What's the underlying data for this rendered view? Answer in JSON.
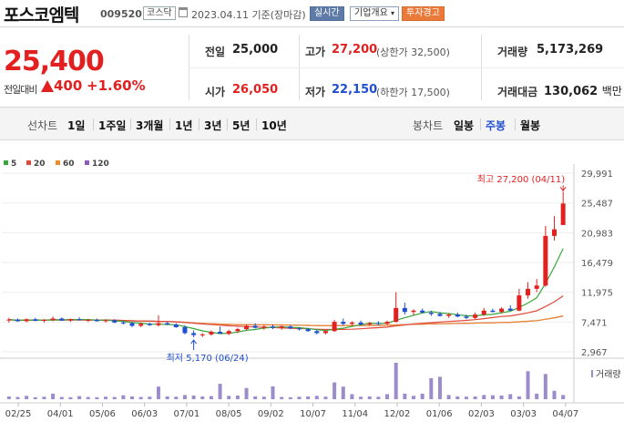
{
  "header": {
    "stock_name": "포스코엠텍",
    "stock_code": "009520",
    "market": "코스닥",
    "date": "2023.04.11",
    "basis": "기준(장마감)",
    "realtime_btn": "실시간",
    "company_info_btn": "기업개요",
    "warning_badge": "투자경고"
  },
  "summary": {
    "current_price": "25,400",
    "change_label": "전일대비",
    "change_value": "400",
    "change_pct": "+1.60%",
    "prev_close": {
      "label": "전일",
      "value": "25,000"
    },
    "high": {
      "label": "고가",
      "value": "27,200",
      "sub_label": "상한가",
      "sub_value": "32,500"
    },
    "volume": {
      "label": "거래량",
      "value": "5,173,269"
    },
    "open": {
      "label": "시가",
      "value": "26,050"
    },
    "low": {
      "label": "저가",
      "value": "22,150",
      "sub_label": "하한가",
      "sub_value": "17,500"
    },
    "amount": {
      "label": "거래대금",
      "value": "130,062",
      "unit": "백만"
    }
  },
  "period_bar": {
    "line_label": "선차트",
    "line_periods": [
      "1일",
      "1주일",
      "3개월",
      "1년",
      "3년",
      "5년",
      "10년"
    ],
    "candle_label": "봉차트",
    "candle_periods": [
      "일봉",
      "주봉",
      "월봉"
    ],
    "active_candle": "주봉"
  },
  "colors": {
    "up": "#e32020",
    "down": "#1f4fd0",
    "ma5": "#3aa63a",
    "ma20": "#e04a3a",
    "ma60": "#f08a2a",
    "ma120": "#8a5ab8",
    "volume": "#9d8ccc"
  },
  "chart_data": {
    "type": "candlestick",
    "legend": [
      {
        "name": "5",
        "color": "#3aa63a"
      },
      {
        "name": "20",
        "color": "#e04a3a"
      },
      {
        "name": "60",
        "color": "#f08a2a"
      },
      {
        "name": "120",
        "color": "#8a5ab8"
      }
    ],
    "y_ticks": [
      "29,991",
      "25,487",
      "20,983",
      "16,479",
      "11,975",
      "7,471",
      "2,967"
    ],
    "ylim": [
      2967,
      29991
    ],
    "x_ticks": [
      "02/25",
      "04/01",
      "05/06",
      "06/03",
      "07/01",
      "08/05",
      "09/02",
      "10/07",
      "11/04",
      "12/02",
      "01/06",
      "02/03",
      "03/03",
      "04/07"
    ],
    "annotation_high": "최고 27,200 (04/11)",
    "annotation_low": "최저 5,170 (06/24)",
    "volume_label": "거래량",
    "candles": [
      {
        "o": 7700,
        "h": 8100,
        "l": 7400,
        "c": 7850
      },
      {
        "o": 7850,
        "h": 8000,
        "l": 7500,
        "c": 7600
      },
      {
        "o": 7600,
        "h": 8000,
        "l": 7450,
        "c": 7900
      },
      {
        "o": 7900,
        "h": 8100,
        "l": 7600,
        "c": 7650
      },
      {
        "o": 7650,
        "h": 7900,
        "l": 7400,
        "c": 7800
      },
      {
        "o": 7800,
        "h": 8300,
        "l": 7600,
        "c": 8000
      },
      {
        "o": 8000,
        "h": 8150,
        "l": 7650,
        "c": 7700
      },
      {
        "o": 7700,
        "h": 8000,
        "l": 7500,
        "c": 7900
      },
      {
        "o": 7900,
        "h": 8200,
        "l": 7700,
        "c": 7750
      },
      {
        "o": 7750,
        "h": 7950,
        "l": 7500,
        "c": 7800
      },
      {
        "o": 7800,
        "h": 8000,
        "l": 7550,
        "c": 7600
      },
      {
        "o": 7600,
        "h": 7900,
        "l": 7400,
        "c": 7750
      },
      {
        "o": 7750,
        "h": 7900,
        "l": 7300,
        "c": 7400
      },
      {
        "o": 7400,
        "h": 7700,
        "l": 7100,
        "c": 7300
      },
      {
        "o": 7300,
        "h": 7500,
        "l": 6700,
        "c": 6900
      },
      {
        "o": 6900,
        "h": 7400,
        "l": 6700,
        "c": 7200
      },
      {
        "o": 7200,
        "h": 7400,
        "l": 6900,
        "c": 7000
      },
      {
        "o": 7000,
        "h": 8500,
        "l": 6800,
        "c": 7300
      },
      {
        "o": 7300,
        "h": 7500,
        "l": 7000,
        "c": 7100
      },
      {
        "o": 7100,
        "h": 7300,
        "l": 6600,
        "c": 6700
      },
      {
        "o": 6700,
        "h": 7000,
        "l": 5600,
        "c": 5800
      },
      {
        "o": 5800,
        "h": 6200,
        "l": 5170,
        "c": 5500
      },
      {
        "o": 5500,
        "h": 5800,
        "l": 5200,
        "c": 5600
      },
      {
        "o": 5600,
        "h": 6200,
        "l": 5400,
        "c": 6000
      },
      {
        "o": 6000,
        "h": 6800,
        "l": 5800,
        "c": 5700
      },
      {
        "o": 5700,
        "h": 6300,
        "l": 5500,
        "c": 6100
      },
      {
        "o": 6100,
        "h": 6600,
        "l": 5800,
        "c": 6400
      },
      {
        "o": 6400,
        "h": 7100,
        "l": 6200,
        "c": 6900
      },
      {
        "o": 6900,
        "h": 7300,
        "l": 6500,
        "c": 6600
      },
      {
        "o": 6600,
        "h": 7000,
        "l": 6300,
        "c": 6800
      },
      {
        "o": 6800,
        "h": 7100,
        "l": 6400,
        "c": 6600
      },
      {
        "o": 6600,
        "h": 7000,
        "l": 6300,
        "c": 6800
      },
      {
        "o": 6800,
        "h": 7000,
        "l": 6400,
        "c": 6500
      },
      {
        "o": 6500,
        "h": 6700,
        "l": 6200,
        "c": 6400
      },
      {
        "o": 6400,
        "h": 6600,
        "l": 6000,
        "c": 6100
      },
      {
        "o": 6100,
        "h": 6300,
        "l": 5600,
        "c": 5800
      },
      {
        "o": 5800,
        "h": 6200,
        "l": 5600,
        "c": 6100
      },
      {
        "o": 6100,
        "h": 7800,
        "l": 6000,
        "c": 7500
      },
      {
        "o": 7500,
        "h": 8000,
        "l": 7000,
        "c": 7200
      },
      {
        "o": 7200,
        "h": 7600,
        "l": 6900,
        "c": 7400
      },
      {
        "o": 7400,
        "h": 7700,
        "l": 7000,
        "c": 7100
      },
      {
        "o": 7100,
        "h": 7500,
        "l": 6900,
        "c": 7300
      },
      {
        "o": 7300,
        "h": 7600,
        "l": 7000,
        "c": 7200
      },
      {
        "o": 7200,
        "h": 7700,
        "l": 7000,
        "c": 7500
      },
      {
        "o": 7500,
        "h": 12000,
        "l": 7400,
        "c": 9600
      },
      {
        "o": 9600,
        "h": 10400,
        "l": 8600,
        "c": 9000
      },
      {
        "o": 9000,
        "h": 9400,
        "l": 8500,
        "c": 9200
      },
      {
        "o": 9200,
        "h": 9500,
        "l": 8800,
        "c": 8900
      },
      {
        "o": 8900,
        "h": 9200,
        "l": 8400,
        "c": 8700
      },
      {
        "o": 8700,
        "h": 9000,
        "l": 8300,
        "c": 8400
      },
      {
        "o": 8400,
        "h": 8800,
        "l": 8100,
        "c": 8600
      },
      {
        "o": 8600,
        "h": 8900,
        "l": 8200,
        "c": 8300
      },
      {
        "o": 8300,
        "h": 8600,
        "l": 7900,
        "c": 8100
      },
      {
        "o": 8100,
        "h": 8900,
        "l": 7900,
        "c": 8600
      },
      {
        "o": 8600,
        "h": 9600,
        "l": 8400,
        "c": 9200
      },
      {
        "o": 9200,
        "h": 9500,
        "l": 8900,
        "c": 9000
      },
      {
        "o": 9000,
        "h": 9700,
        "l": 8800,
        "c": 9500
      },
      {
        "o": 9500,
        "h": 10000,
        "l": 9200,
        "c": 9200
      },
      {
        "o": 9200,
        "h": 12500,
        "l": 9100,
        "c": 11500
      },
      {
        "o": 11500,
        "h": 13500,
        "l": 11000,
        "c": 12500
      },
      {
        "o": 12500,
        "h": 14000,
        "l": 12000,
        "c": 13000
      },
      {
        "o": 13000,
        "h": 22000,
        "l": 12800,
        "c": 20500
      },
      {
        "o": 20500,
        "h": 23500,
        "l": 19800,
        "c": 21500
      },
      {
        "o": 22150,
        "h": 27200,
        "l": 22150,
        "c": 25400
      }
    ],
    "volumes": [
      1.0,
      0.8,
      1.2,
      0.7,
      0.9,
      2.0,
      0.8,
      0.7,
      1.1,
      0.8,
      0.7,
      0.9,
      0.8,
      1.4,
      1.0,
      0.8,
      0.9,
      4.5,
      1.0,
      0.9,
      1.5,
      1.3,
      1.0,
      1.1,
      5.5,
      1.2,
      1.3,
      4.0,
      1.0,
      0.9,
      4.6,
      0.8,
      0.7,
      0.9,
      1.0,
      1.2,
      0.9,
      6.0,
      4.5,
      1.8,
      0.9,
      1.0,
      0.9,
      1.8,
      13.0,
      2.0,
      1.2,
      2.0,
      7.5,
      8.0,
      1.5,
      1.0,
      0.9,
      1.0,
      1.5,
      1.4,
      1.3,
      1.8,
      1.0,
      10.0,
      2.0,
      9.0,
      3.0,
      1.5
    ]
  }
}
